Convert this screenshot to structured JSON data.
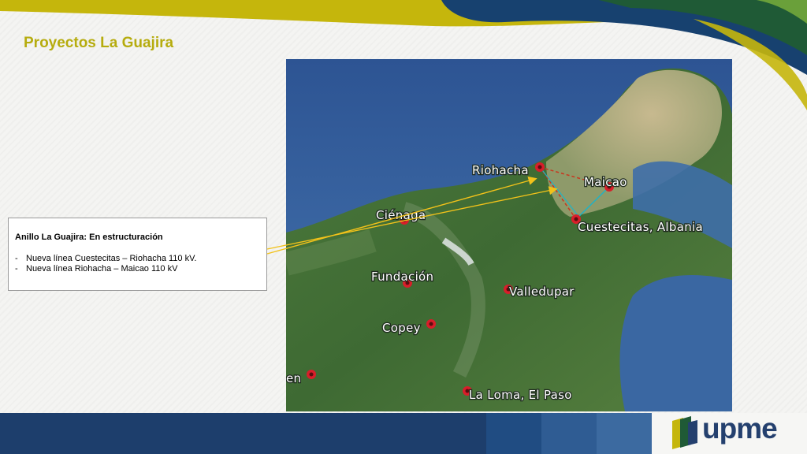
{
  "slide": {
    "title": "Proyectos La Guajira"
  },
  "info_box": {
    "heading": "Anillo La Guajira: En estructuración",
    "items": [
      "Nueva línea Cuestecitas – Riohacha  110 kV.",
      "Nueva línea Riohacha – Maicao 110 kV"
    ],
    "bullet": "-"
  },
  "map": {
    "cities": [
      "Riohacha",
      "Maicao",
      "Ciénaga",
      "Cuestecitas, Albania",
      "Fundación",
      "Valledupar",
      "Copey",
      "en",
      "La Loma, El Paso"
    ]
  },
  "colors": {
    "title": "#b6ac0e",
    "footer_navy": "#1d3e6c",
    "logo_blue": "#24406e",
    "arrow": "#f2c21a",
    "marker": "#d81e2a"
  },
  "logo": {
    "text": "upme",
    "icon": "upme-logo-mark"
  }
}
